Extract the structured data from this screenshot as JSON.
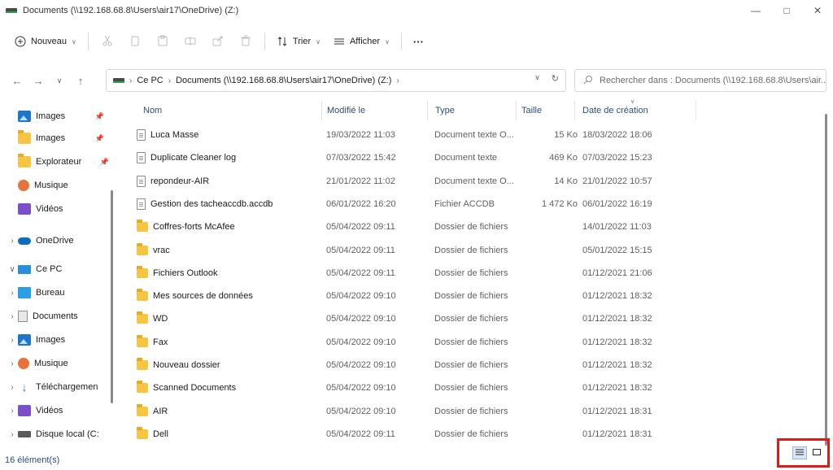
{
  "window": {
    "title": "Documents (\\\\192.168.68.8\\Users\\air17\\OneDrive) (Z:)"
  },
  "toolbar": {
    "new_label": "Nouveau",
    "sort_label": "Trier",
    "view_label": "Afficher",
    "more_label": "···"
  },
  "address": {
    "crumb_pc": "Ce PC",
    "crumb_docs": "Documents (\\\\192.168.68.8\\Users\\air17\\OneDrive) (Z:)",
    "search_placeholder": "Rechercher dans : Documents (\\\\192.168.68.8\\Users\\air..."
  },
  "sidebar": {
    "items": [
      {
        "label": "Images",
        "icon": "images-icon",
        "pinned": true
      },
      {
        "label": "Images",
        "icon": "folder-icon",
        "pinned": true
      },
      {
        "label": "Explorateur",
        "icon": "folder-icon",
        "pinned": true
      },
      {
        "label": "Musique",
        "icon": "music-icon"
      },
      {
        "label": "Vidéos",
        "icon": "videos-icon"
      },
      {
        "label": "OneDrive",
        "icon": "cloud-icon"
      },
      {
        "label": "Ce PC",
        "icon": "pc-icon"
      },
      {
        "label": "Bureau",
        "icon": "desktop-icon"
      },
      {
        "label": "Documents",
        "icon": "documents-icon"
      },
      {
        "label": "Images",
        "icon": "images-icon"
      },
      {
        "label": "Musique",
        "icon": "music-icon"
      },
      {
        "label": "Téléchargemen",
        "icon": "download-icon"
      },
      {
        "label": "Vidéos",
        "icon": "videos-icon"
      },
      {
        "label": "Disque local (C:",
        "icon": "disk-icon"
      }
    ]
  },
  "columns": {
    "name": "Nom",
    "modified": "Modifié le",
    "type": "Type",
    "size": "Taille",
    "created": "Date de création"
  },
  "files": [
    {
      "name": "Luca Masse",
      "modified": "19/03/2022 11:03",
      "type": "Document texte O...",
      "size": "15 Ko",
      "created": "18/03/2022 18:06",
      "kind": "doc"
    },
    {
      "name": "Duplicate Cleaner log",
      "modified": "07/03/2022 15:42",
      "type": "Document texte",
      "size": "469 Ko",
      "created": "07/03/2022 15:23",
      "kind": "doc"
    },
    {
      "name": "repondeur-AIR",
      "modified": "21/01/2022 11:02",
      "type": "Document texte O...",
      "size": "14 Ko",
      "created": "21/01/2022 10:57",
      "kind": "doc"
    },
    {
      "name": "Gestion des tacheaccdb.accdb",
      "modified": "06/01/2022 16:20",
      "type": "Fichier ACCDB",
      "size": "1 472 Ko",
      "created": "06/01/2022 16:19",
      "kind": "doc"
    },
    {
      "name": "Coffres-forts McAfee",
      "modified": "05/04/2022 09:11",
      "type": "Dossier de fichiers",
      "size": "",
      "created": "14/01/2022 11:03",
      "kind": "folder"
    },
    {
      "name": "vrac",
      "modified": "05/04/2022 09:11",
      "type": "Dossier de fichiers",
      "size": "",
      "created": "05/01/2022 15:15",
      "kind": "folder"
    },
    {
      "name": "Fichiers Outlook",
      "modified": "05/04/2022 09:11",
      "type": "Dossier de fichiers",
      "size": "",
      "created": "01/12/2021 21:06",
      "kind": "folder"
    },
    {
      "name": "Mes sources de données",
      "modified": "05/04/2022 09:10",
      "type": "Dossier de fichiers",
      "size": "",
      "created": "01/12/2021 18:32",
      "kind": "folder"
    },
    {
      "name": "WD",
      "modified": "05/04/2022 09:10",
      "type": "Dossier de fichiers",
      "size": "",
      "created": "01/12/2021 18:32",
      "kind": "folder"
    },
    {
      "name": "Fax",
      "modified": "05/04/2022 09:10",
      "type": "Dossier de fichiers",
      "size": "",
      "created": "01/12/2021 18:32",
      "kind": "folder"
    },
    {
      "name": "Nouveau dossier",
      "modified": "05/04/2022 09:10",
      "type": "Dossier de fichiers",
      "size": "",
      "created": "01/12/2021 18:32",
      "kind": "folder"
    },
    {
      "name": "Scanned Documents",
      "modified": "05/04/2022 09:10",
      "type": "Dossier de fichiers",
      "size": "",
      "created": "01/12/2021 18:32",
      "kind": "folder"
    },
    {
      "name": "AIR",
      "modified": "05/04/2022 09:10",
      "type": "Dossier de fichiers",
      "size": "",
      "created": "01/12/2021 18:31",
      "kind": "folder"
    },
    {
      "name": "Dell",
      "modified": "05/04/2022 09:11",
      "type": "Dossier de fichiers",
      "size": "",
      "created": "01/12/2021 18:31",
      "kind": "folder"
    }
  ],
  "status": {
    "count": "16 élément(s)"
  }
}
